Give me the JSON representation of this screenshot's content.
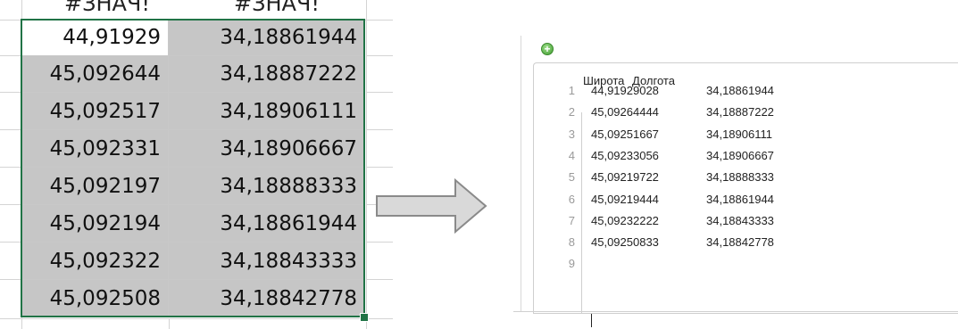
{
  "sheet": {
    "header_cells": [
      "#ЗНАЧ!",
      "#ЗНАЧ!"
    ],
    "rows": [
      [
        "44,91929",
        "34,18861944"
      ],
      [
        "45,092644",
        "34,18887222"
      ],
      [
        "45,092517",
        "34,18906111"
      ],
      [
        "45,092331",
        "34,18906667"
      ],
      [
        "45,092197",
        "34,18888333"
      ],
      [
        "45,092194",
        "34,18861944"
      ],
      [
        "45,092322",
        "34,18843333"
      ],
      [
        "45,092508",
        "34,18842778"
      ]
    ],
    "accent_color": "#217346",
    "selection_fill": "#c6c6c6"
  },
  "arrow": {
    "icon": "right-arrow-icon",
    "color": "#d9d9d9"
  },
  "editor": {
    "add_icon": "add-circle-icon",
    "headers": [
      "Широта",
      "Долгота"
    ],
    "lines": [
      {
        "n": "1",
        "lat": "44,91929028",
        "lon": "34,18861944"
      },
      {
        "n": "2",
        "lat": "45,09264444",
        "lon": "34,18887222"
      },
      {
        "n": "3",
        "lat": "45,09251667",
        "lon": "34,18906111"
      },
      {
        "n": "4",
        "lat": "45,09233056",
        "lon": "34,18906667"
      },
      {
        "n": "5",
        "lat": "45,09219722",
        "lon": "34,18888333"
      },
      {
        "n": "6",
        "lat": "45,09219444",
        "lon": "34,18861944"
      },
      {
        "n": "7",
        "lat": "45,09232222",
        "lon": "34,18843333"
      },
      {
        "n": "8",
        "lat": "45,09250833",
        "lon": "34,18842778"
      },
      {
        "n": "9",
        "lat": "",
        "lon": ""
      }
    ]
  }
}
